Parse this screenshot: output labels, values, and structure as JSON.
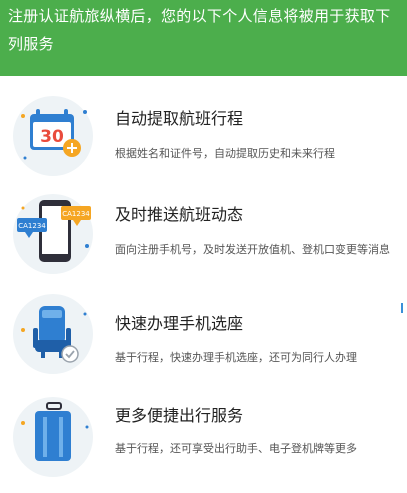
{
  "header": {
    "text": "注册认证航旅纵横后，您的以下个人信息将被用于获取下列服务"
  },
  "features": [
    {
      "title": "自动提取航班行程",
      "desc": "根据姓名和证件号，自动提取历史和未来行程",
      "icon": "calendar-icon",
      "calendar_number": "30"
    },
    {
      "title": "及时推送航班动态",
      "desc": "面向注册手机号，及时发送开放值机、登机口变更等消息",
      "icon": "phone-notification-icon",
      "bubble_left": "CA1234",
      "bubble_right": "CA1234"
    },
    {
      "title": "快速办理手机选座",
      "desc": "基于行程，快速办理手机选座，还可为同行人办理",
      "icon": "seat-icon"
    },
    {
      "title": "更多便捷出行服务",
      "desc": "基于行程，还可享受出行助手、电子登机牌等更多",
      "icon": "luggage-icon"
    }
  ],
  "colors": {
    "header_bg": "#4cae4c",
    "accent_blue": "#2f7fd1",
    "accent_orange": "#f5a623",
    "calendar_red": "#e94b3c"
  }
}
